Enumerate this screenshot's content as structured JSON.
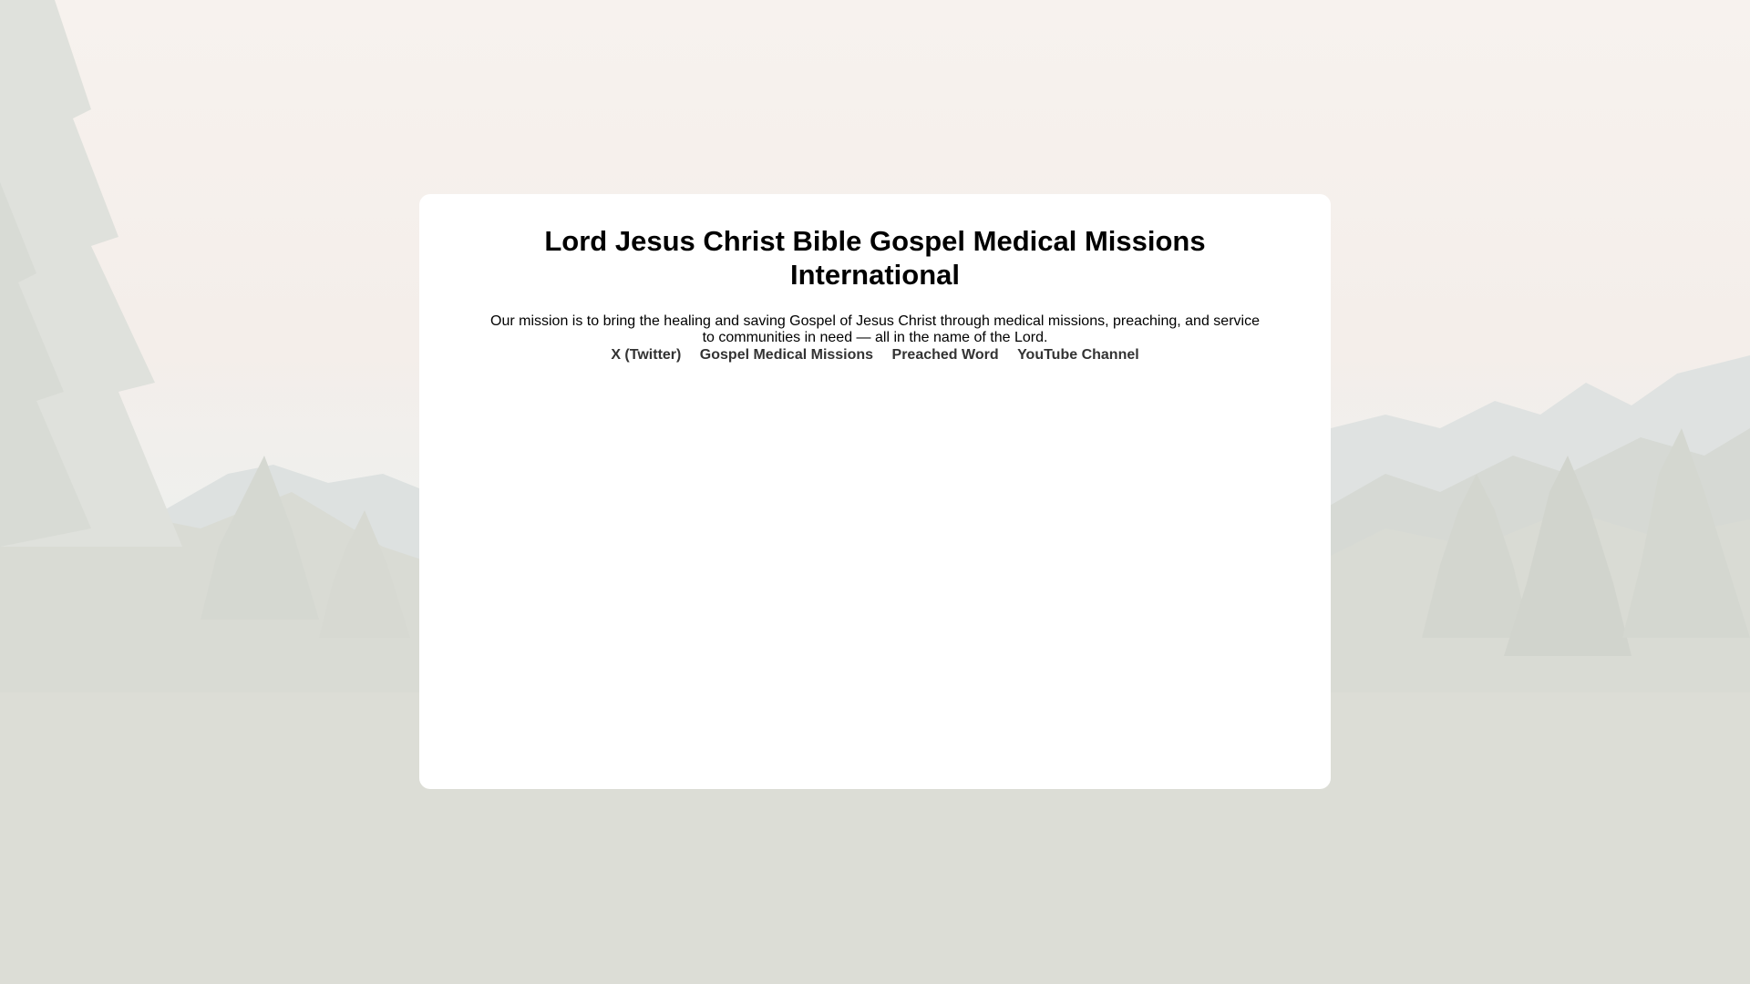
{
  "header": {
    "title": "Lord Jesus Christ Bible Gospel Medical Missions International"
  },
  "main": {
    "mission": "Our mission is to bring the healing and saving Gospel of Jesus Christ through medical missions, preaching, and service to communities in need — all in the name of the Lord."
  },
  "links": [
    {
      "label": "X (Twitter)"
    },
    {
      "label": "Gospel Medical Missions"
    },
    {
      "label": "Preached Word"
    },
    {
      "label": "YouTube Channel"
    }
  ],
  "colors": {
    "card_background": "#ffffff",
    "link": "#333333",
    "text": "#000000"
  },
  "background": {
    "description_icon": "mountain-forest-icon"
  }
}
